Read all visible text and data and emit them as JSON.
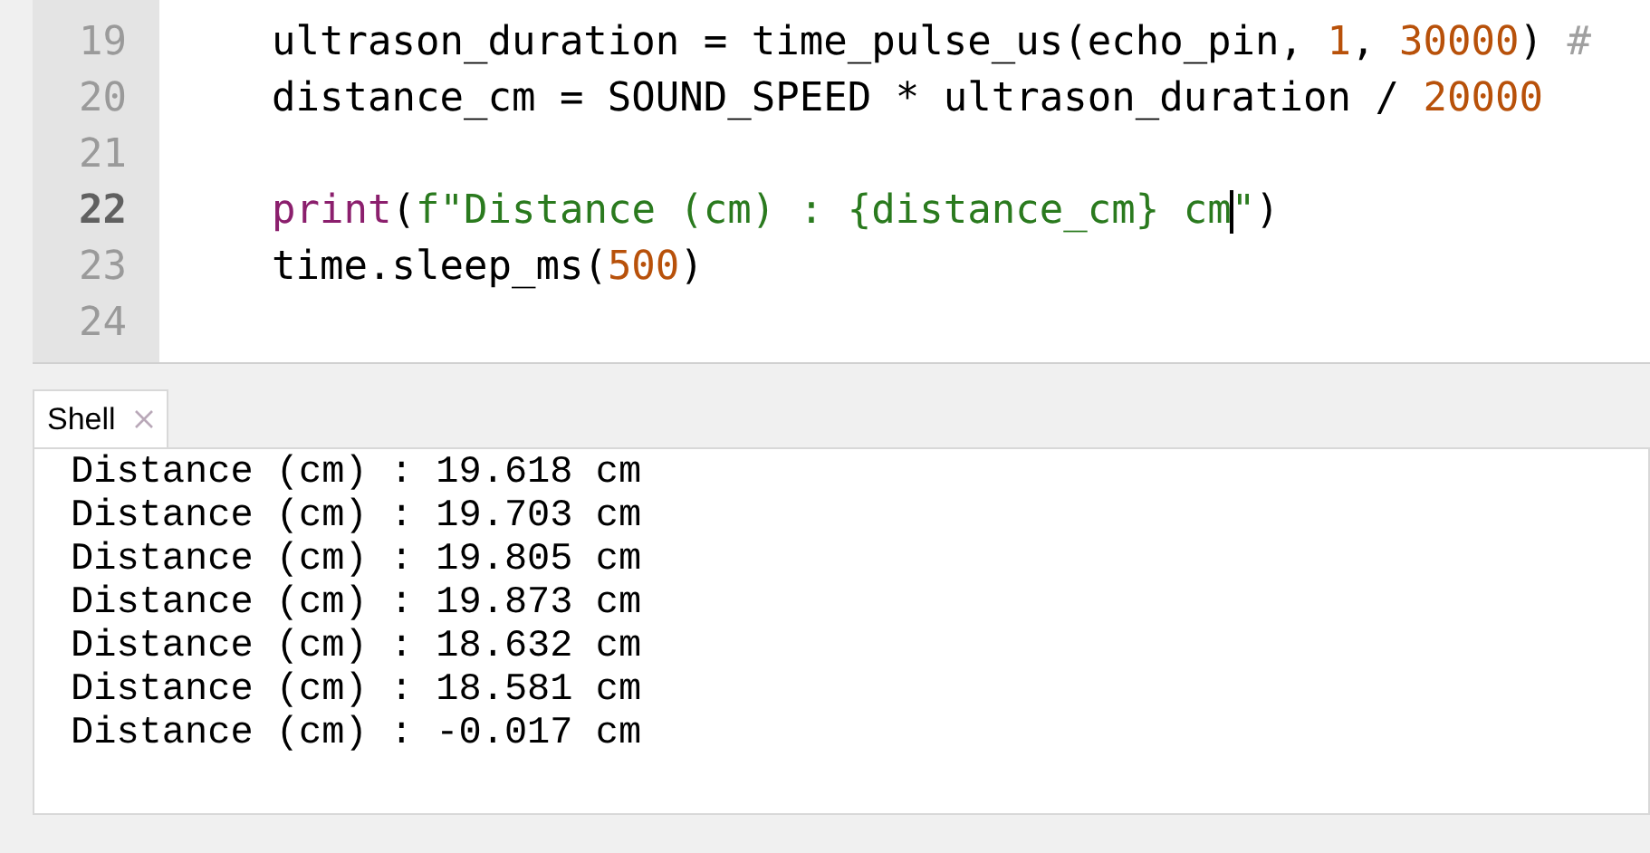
{
  "editor": {
    "lines": [
      {
        "number": "19",
        "current": false,
        "tokens": [
          {
            "kind": "plain",
            "text": "ultrason_duration = time_pulse_us(echo_pin, "
          },
          {
            "kind": "number",
            "text": "1"
          },
          {
            "kind": "plain",
            "text": ", "
          },
          {
            "kind": "number",
            "text": "30000"
          },
          {
            "kind": "plain",
            "text": ") "
          },
          {
            "kind": "comment",
            "text": "#"
          }
        ]
      },
      {
        "number": "20",
        "current": false,
        "tokens": [
          {
            "kind": "plain",
            "text": "distance_cm = SOUND_SPEED * ultrason_duration / "
          },
          {
            "kind": "number",
            "text": "20000"
          }
        ]
      },
      {
        "number": "21",
        "current": false
      },
      {
        "number": "22",
        "current": true,
        "tokens": [
          {
            "kind": "builtin",
            "text": "print"
          },
          {
            "kind": "plain",
            "text": "("
          },
          {
            "kind": "string",
            "text": "f\"Distance (cm) : {distance_cm} cm"
          },
          {
            "kind": "caret"
          },
          {
            "kind": "string",
            "text": "\""
          },
          {
            "kind": "plain",
            "text": ")"
          }
        ]
      },
      {
        "number": "23",
        "current": false,
        "tokens": [
          {
            "kind": "plain",
            "text": "time.sleep_ms("
          },
          {
            "kind": "number",
            "text": "500"
          },
          {
            "kind": "plain",
            "text": ")"
          }
        ]
      },
      {
        "number": "24",
        "current": false
      }
    ]
  },
  "shell": {
    "tab": {
      "label": "Shell",
      "selected": true
    },
    "output": [
      "Distance (cm) : 19.618 cm",
      "Distance (cm) : 19.703 cm",
      "Distance (cm) : 19.805 cm",
      "Distance (cm) : 19.873 cm",
      "Distance (cm) : 18.632 cm",
      "Distance (cm) : 18.581 cm",
      "Distance (cm) : -0.017 cm"
    ]
  }
}
